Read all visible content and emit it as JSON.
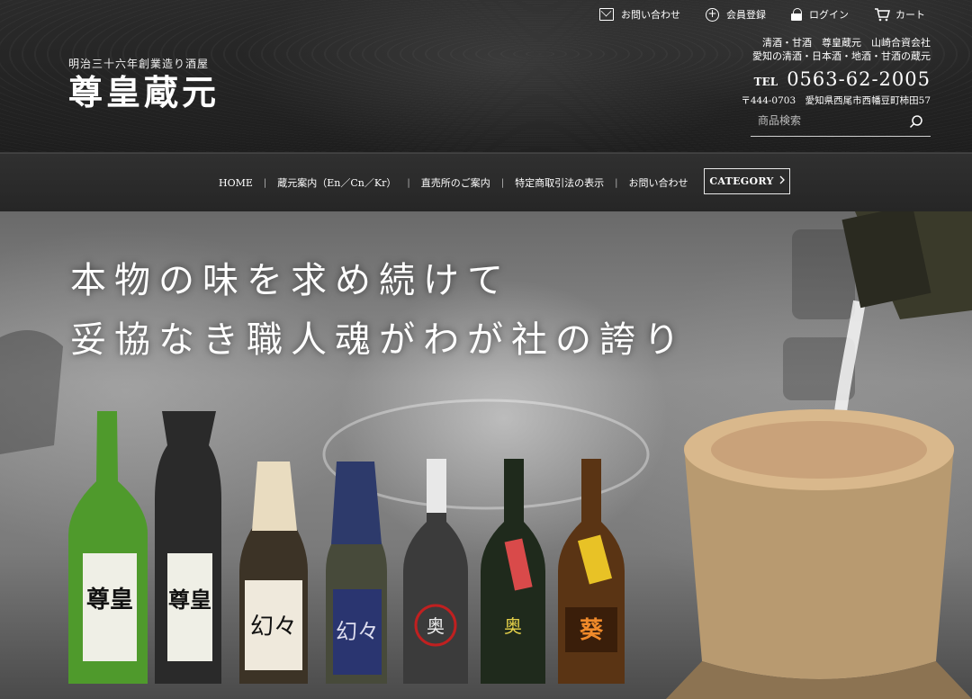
{
  "header": {
    "logo_sub": "明治三十六年創業造り酒屋",
    "logo_main": "尊皇蔵元",
    "top_links": {
      "contact": "お問い合わせ",
      "member": "会員登録",
      "login": "ログイン",
      "cart": "カート"
    },
    "company_line1": "清酒・甘酒　尊皇蔵元　山崎合資会社",
    "company_line2": "愛知の清酒・日本酒・地酒・甘酒の蔵元",
    "tel_label": "TEL",
    "tel_number": "0563-62-2005",
    "address": "〒444-0703　愛知県西尾市西幡豆町柿田57",
    "search_placeholder": "商品検索"
  },
  "nav": {
    "items": [
      "HOME",
      "蔵元案内（En／Cn／Kr）",
      "直売所のご案内",
      "特定商取引法の表示",
      "お問い合わせ"
    ],
    "separator": "|",
    "category_button": "CATEGORY"
  },
  "hero": {
    "catch_line1": "本物の味を求め続けて",
    "catch_line2": "妥協なき職人魂がわが社の誇り",
    "bottle_labels": [
      "尊皇",
      "尊皇",
      "幻々",
      "幻々",
      "奥",
      "奥",
      "葵"
    ]
  },
  "colors": {
    "header_bg": "#252525",
    "nav_bg": "#2b2b2b",
    "text": "#ffffff"
  }
}
